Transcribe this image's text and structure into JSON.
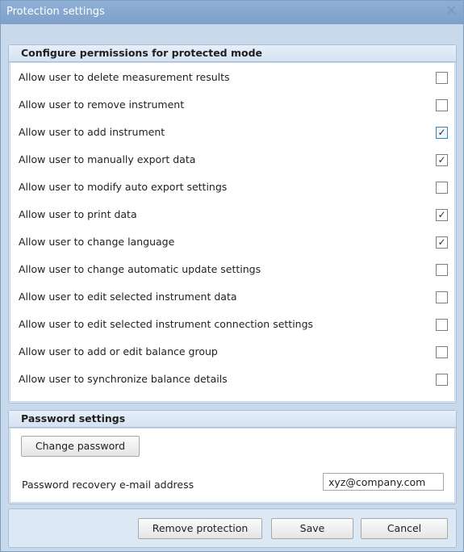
{
  "window": {
    "title": "Protection settings",
    "close_icon": "close-icon"
  },
  "permissions": {
    "header": "Configure permissions for protected mode",
    "items": [
      {
        "label": "Allow user to delete measurement results",
        "checked": false
      },
      {
        "label": "Allow user to remove instrument",
        "checked": false
      },
      {
        "label": "Allow user to add instrument",
        "checked": true
      },
      {
        "label": "Allow user to manually export data",
        "checked": true
      },
      {
        "label": "Allow user to modify auto export settings",
        "checked": false
      },
      {
        "label": "Allow user to print data",
        "checked": true
      },
      {
        "label": "Allow user to change language",
        "checked": true
      },
      {
        "label": "Allow user to change automatic update settings",
        "checked": false
      },
      {
        "label": "Allow user to edit selected instrument data",
        "checked": false
      },
      {
        "label": "Allow user to edit selected instrument connection settings",
        "checked": false
      },
      {
        "label": "Allow user to add or edit balance group",
        "checked": false
      },
      {
        "label": "Allow user to synchronize balance details",
        "checked": false
      }
    ]
  },
  "password": {
    "header": "Password settings",
    "change_button": "Change password",
    "email_label": "Password recovery e-mail address",
    "email_value": "xyz@company.com"
  },
  "footer": {
    "remove_button": "Remove protection",
    "save_button": "Save",
    "cancel_button": "Cancel"
  }
}
